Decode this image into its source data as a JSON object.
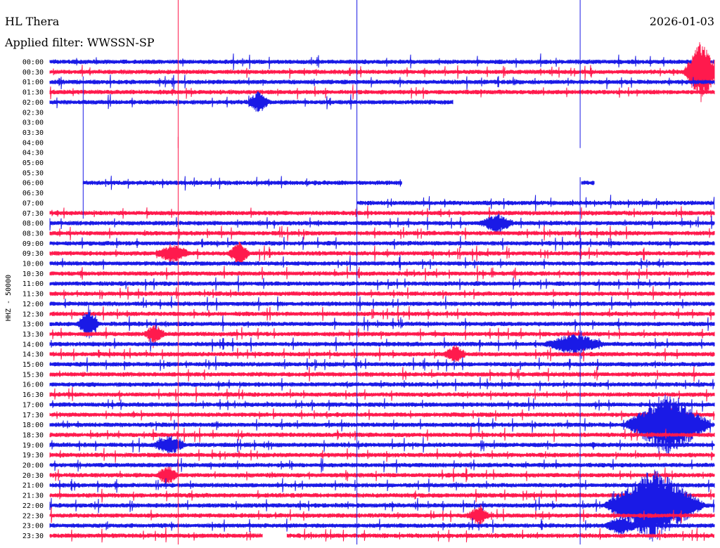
{
  "header": {
    "station": "HL Thera",
    "filter": "Applied filter: WWSSN-SP",
    "date": "2026-01-03"
  },
  "chart_data": {
    "type": "line",
    "title": "HL Thera",
    "subtitle": "Applied filter: WWSSN-SP",
    "ylabel": "HHZ - 50000",
    "xlabel": "",
    "row_labels": [
      "00:00",
      "00:30",
      "01:00",
      "01:30",
      "02:00",
      "02:30",
      "03:00",
      "03:30",
      "04:00",
      "04:30",
      "05:00",
      "05:30",
      "06:00",
      "06:30",
      "07:00",
      "07:30",
      "08:00",
      "08:30",
      "09:00",
      "09:30",
      "10:00",
      "10:30",
      "11:00",
      "11:30",
      "12:00",
      "12:30",
      "13:00",
      "13:30",
      "14:00",
      "14:30",
      "15:00",
      "15:30",
      "16:00",
      "16:30",
      "17:00",
      "17:30",
      "18:00",
      "18:30",
      "19:00",
      "19:30",
      "20:00",
      "20:30",
      "21:00",
      "21:30",
      "22:00",
      "22:30",
      "23:00",
      "23:30"
    ],
    "row_minutes": 30,
    "colors": {
      "even": "#1a1ae6",
      "odd": "#ff1a4d"
    },
    "data_segments": [
      {
        "row": 0,
        "from": 0.0,
        "to": 1.0
      },
      {
        "row": 1,
        "from": 0.0,
        "to": 1.0
      },
      {
        "row": 2,
        "from": 0.0,
        "to": 1.0
      },
      {
        "row": 3,
        "from": 0.0,
        "to": 1.0
      },
      {
        "row": 4,
        "from": 0.0,
        "to": 0.607
      },
      {
        "row": 12,
        "from": 0.05,
        "to": 0.53
      },
      {
        "row": 12,
        "from": 0.8,
        "to": 0.82
      },
      {
        "row": 14,
        "from": 0.462,
        "to": 1.0
      },
      {
        "row": 15,
        "from": 0.0,
        "to": 1.0
      },
      {
        "row": 16,
        "from": 0.0,
        "to": 1.0
      },
      {
        "row": 17,
        "from": 0.0,
        "to": 1.0
      },
      {
        "row": 18,
        "from": 0.0,
        "to": 1.0
      },
      {
        "row": 19,
        "from": 0.0,
        "to": 1.0
      },
      {
        "row": 20,
        "from": 0.0,
        "to": 1.0
      },
      {
        "row": 21,
        "from": 0.0,
        "to": 1.0
      },
      {
        "row": 22,
        "from": 0.0,
        "to": 1.0
      },
      {
        "row": 23,
        "from": 0.0,
        "to": 1.0
      },
      {
        "row": 24,
        "from": 0.0,
        "to": 1.0
      },
      {
        "row": 25,
        "from": 0.0,
        "to": 1.0
      },
      {
        "row": 26,
        "from": 0.0,
        "to": 1.0
      },
      {
        "row": 27,
        "from": 0.0,
        "to": 1.0
      },
      {
        "row": 28,
        "from": 0.0,
        "to": 1.0
      },
      {
        "row": 29,
        "from": 0.0,
        "to": 1.0
      },
      {
        "row": 30,
        "from": 0.0,
        "to": 1.0
      },
      {
        "row": 31,
        "from": 0.0,
        "to": 1.0
      },
      {
        "row": 32,
        "from": 0.0,
        "to": 1.0
      },
      {
        "row": 33,
        "from": 0.0,
        "to": 1.0
      },
      {
        "row": 34,
        "from": 0.0,
        "to": 1.0
      },
      {
        "row": 35,
        "from": 0.0,
        "to": 1.0
      },
      {
        "row": 36,
        "from": 0.0,
        "to": 1.0
      },
      {
        "row": 37,
        "from": 0.0,
        "to": 1.0
      },
      {
        "row": 38,
        "from": 0.0,
        "to": 1.0
      },
      {
        "row": 39,
        "from": 0.0,
        "to": 1.0
      },
      {
        "row": 40,
        "from": 0.0,
        "to": 1.0
      },
      {
        "row": 41,
        "from": 0.0,
        "to": 1.0
      },
      {
        "row": 42,
        "from": 0.0,
        "to": 1.0
      },
      {
        "row": 43,
        "from": 0.0,
        "to": 1.0
      },
      {
        "row": 44,
        "from": 0.0,
        "to": 1.0
      },
      {
        "row": 45,
        "from": 0.0,
        "to": 1.0
      },
      {
        "row": 46,
        "from": 0.0,
        "to": 1.0
      },
      {
        "row": 47,
        "from": 0.0,
        "to": 0.32
      },
      {
        "row": 47,
        "from": 0.357,
        "to": 1.0
      }
    ],
    "spikes": [
      {
        "from_row": 0,
        "to_row": 8,
        "at": 0.193,
        "color": "odd"
      },
      {
        "from_row": 0,
        "to_row": 16,
        "at": 0.462,
        "color": "even"
      },
      {
        "from_row": 0,
        "to_row": 8,
        "at": 0.798,
        "color": "even"
      },
      {
        "from_row": 2,
        "to_row": 15,
        "at": 0.05,
        "color": "even"
      },
      {
        "from_row": 8,
        "to_row": 47,
        "at": 0.193,
        "color": "odd"
      },
      {
        "from_row": 15,
        "to_row": 47,
        "at": 0.462,
        "color": "even"
      },
      {
        "from_row": 12,
        "to_row": 47,
        "at": 0.798,
        "color": "even"
      }
    ],
    "events": [
      {
        "row": 1,
        "at": 0.98,
        "amp": 3.0,
        "span": 0.02
      },
      {
        "row": 4,
        "at": 0.314,
        "amp": 1.0,
        "span": 0.01
      },
      {
        "row": 19,
        "at": 0.185,
        "amp": 0.8,
        "span": 0.02
      },
      {
        "row": 19,
        "at": 0.285,
        "amp": 1.1,
        "span": 0.01
      },
      {
        "row": 16,
        "at": 0.673,
        "amp": 0.8,
        "span": 0.02
      },
      {
        "row": 26,
        "at": 0.058,
        "amp": 1.5,
        "span": 0.01
      },
      {
        "row": 27,
        "at": 0.158,
        "amp": 0.8,
        "span": 0.01
      },
      {
        "row": 28,
        "at": 0.79,
        "amp": 0.9,
        "span": 0.04
      },
      {
        "row": 29,
        "at": 0.61,
        "amp": 0.8,
        "span": 0.01
      },
      {
        "row": 36,
        "at": 0.93,
        "amp": 3.0,
        "span": 0.06
      },
      {
        "row": 38,
        "at": 0.18,
        "amp": 0.8,
        "span": 0.02
      },
      {
        "row": 41,
        "at": 0.177,
        "amp": 0.9,
        "span": 0.01
      },
      {
        "row": 44,
        "at": 0.91,
        "amp": 3.6,
        "span": 0.07
      },
      {
        "row": 45,
        "at": 0.645,
        "amp": 0.9,
        "span": 0.01
      },
      {
        "row": 46,
        "at": 0.86,
        "amp": 0.8,
        "span": 0.02
      }
    ]
  }
}
